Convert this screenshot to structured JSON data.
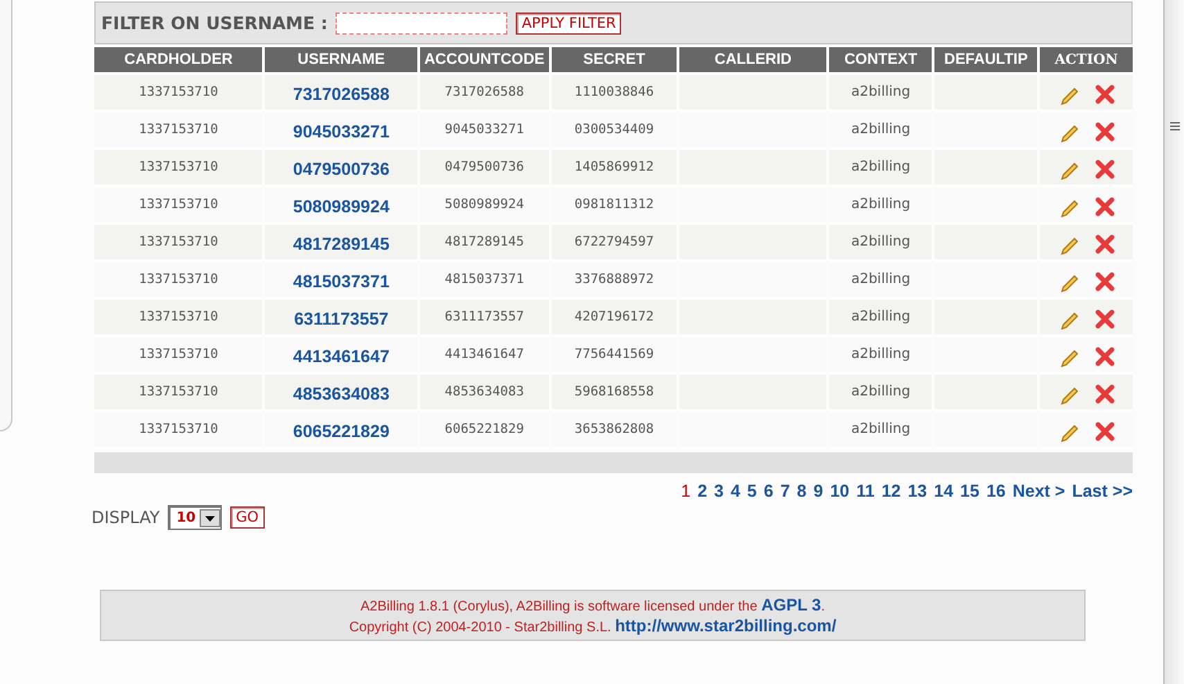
{
  "filter": {
    "label": "FILTER ON USERNAME :",
    "button": "APPLY FILTER"
  },
  "table": {
    "columns": [
      "CARDHOLDER",
      "USERNAME",
      "ACCOUNTCODE",
      "SECRET",
      "CALLERID",
      "CONTEXT",
      "DEFAULTIP",
      "ACTION"
    ],
    "rows": [
      {
        "cardholder": "1337153710",
        "username": "7317026588",
        "accountcode": "7317026588",
        "secret": "1110038846",
        "context": "a2billing"
      },
      {
        "cardholder": "1337153710",
        "username": "9045033271",
        "accountcode": "9045033271",
        "secret": "0300534409",
        "context": "a2billing"
      },
      {
        "cardholder": "1337153710",
        "username": "0479500736",
        "accountcode": "0479500736",
        "secret": "1405869912",
        "context": "a2billing"
      },
      {
        "cardholder": "1337153710",
        "username": "5080989924",
        "accountcode": "5080989924",
        "secret": "0981811312",
        "context": "a2billing"
      },
      {
        "cardholder": "1337153710",
        "username": "4817289145",
        "accountcode": "4817289145",
        "secret": "6722794597",
        "context": "a2billing"
      },
      {
        "cardholder": "1337153710",
        "username": "4815037371",
        "accountcode": "4815037371",
        "secret": "3376888972",
        "context": "a2billing"
      },
      {
        "cardholder": "1337153710",
        "username": "6311173557",
        "accountcode": "6311173557",
        "secret": "4207196172",
        "context": "a2billing"
      },
      {
        "cardholder": "1337153710",
        "username": "4413461647",
        "accountcode": "4413461647",
        "secret": "7756441569",
        "context": "a2billing"
      },
      {
        "cardholder": "1337153710",
        "username": "4853634083",
        "accountcode": "4853634083",
        "secret": "5968168558",
        "context": "a2billing"
      },
      {
        "cardholder": "1337153710",
        "username": "6065221829",
        "accountcode": "6065221829",
        "secret": "3653862808",
        "context": "a2billing"
      }
    ]
  },
  "pagination": {
    "pages": [
      {
        "label": "1",
        "selected": true
      },
      {
        "label": "2",
        "selected": false
      },
      {
        "label": "3",
        "selected": false
      },
      {
        "label": "4",
        "selected": false
      },
      {
        "label": "5",
        "selected": false
      },
      {
        "label": "6",
        "selected": false
      },
      {
        "label": "7",
        "selected": false
      },
      {
        "label": "8",
        "selected": false
      },
      {
        "label": "9",
        "selected": false
      },
      {
        "label": "10",
        "selected": false
      },
      {
        "label": "11",
        "selected": false
      },
      {
        "label": "12",
        "selected": false
      },
      {
        "label": "13",
        "selected": false
      },
      {
        "label": "14",
        "selected": false
      },
      {
        "label": "15",
        "selected": false
      },
      {
        "label": "16",
        "selected": false
      }
    ],
    "next": "Next >",
    "last": "Last >>"
  },
  "display": {
    "label": "DISPLAY",
    "value": "10",
    "button": "GO"
  },
  "footer": {
    "lines": [
      [
        {
          "kind": "text",
          "text": "A2Billing 1.8.1 (Corylus), A2Billing is software licensed under the "
        },
        {
          "kind": "link",
          "text": "AGPL 3"
        },
        {
          "kind": "text",
          "text": "."
        }
      ],
      [
        {
          "kind": "text",
          "text": "Copyright (C) 2004-2010 - Star2billing S.L. "
        },
        {
          "kind": "link",
          "text": "http://www.star2billing.com/"
        }
      ]
    ]
  }
}
